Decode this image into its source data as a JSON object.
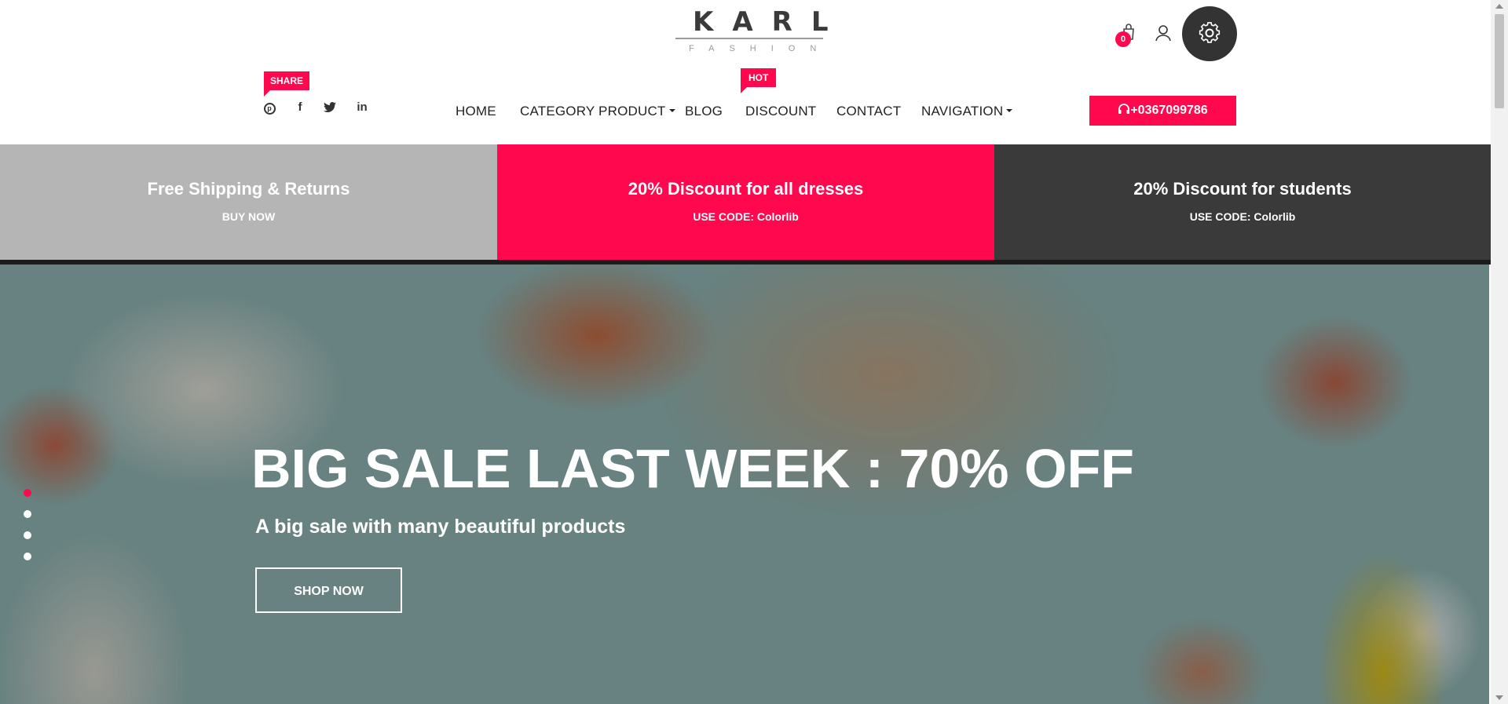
{
  "logo": {
    "main": "KARL",
    "sub": "FASHION"
  },
  "social": {
    "badge": "SHARE",
    "icons": [
      "pinterest-icon",
      "facebook-icon",
      "twitter-icon",
      "linkedin-icon"
    ]
  },
  "nav": {
    "hot_badge": "HOT",
    "items": [
      "HOME",
      "CATEGORY PRODUCT",
      "BLOG",
      "DISCOUNT",
      "CONTACT",
      "NAVIGATION"
    ]
  },
  "cart": {
    "count": "0"
  },
  "phone": "+0367099786",
  "promos": [
    {
      "title": "Free Shipping & Returns",
      "sub": "BUY NOW",
      "color": "#b5b5b5"
    },
    {
      "title": "20% Discount for all dresses",
      "sub": "USE CODE: Colorlib",
      "color": "#ff084e"
    },
    {
      "title": "20% Discount for students",
      "sub": "USE CODE: Colorlib",
      "color": "#3a3a3a"
    }
  ],
  "hero": {
    "title": "BIG SALE LAST WEEK : 70% OFF",
    "subtitle": "A big sale with many beautiful products",
    "button": "SHOP NOW",
    "slides": 4,
    "active_slide": 1
  },
  "colors": {
    "accent": "#ff084e",
    "dark": "#333333"
  }
}
